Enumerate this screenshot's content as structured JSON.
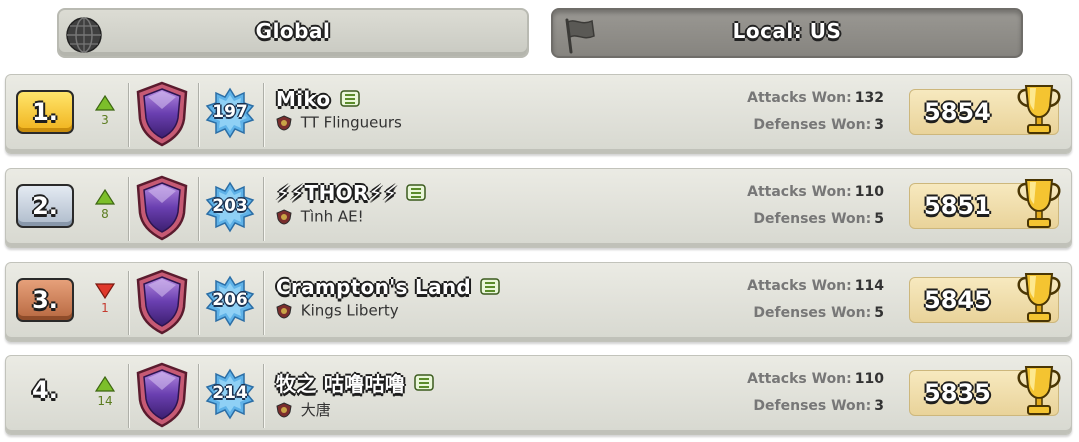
{
  "tabs": {
    "global": {
      "label": "Global",
      "icon": "globe-icon"
    },
    "local": {
      "label": "Local: US",
      "icon": "flag-icon"
    }
  },
  "labels": {
    "attacks_won": "Attacks Won:",
    "defenses_won": "Defenses Won:"
  },
  "players": [
    {
      "rank": "1.",
      "trend": "up",
      "trend_value": "3",
      "level": "197",
      "name": "Miko",
      "clan": "TT Flingueurs",
      "attacks_won": "132",
      "defenses_won": "3",
      "trophies": "5854"
    },
    {
      "rank": "2.",
      "trend": "up",
      "trend_value": "8",
      "level": "203",
      "name": "⚡⚡THOR⚡⚡",
      "clan": "Tình AE!",
      "attacks_won": "110",
      "defenses_won": "5",
      "trophies": "5851"
    },
    {
      "rank": "3.",
      "trend": "down",
      "trend_value": "1",
      "level": "206",
      "name": "Crampton's Land",
      "clan": "Kings Liberty",
      "attacks_won": "114",
      "defenses_won": "5",
      "trophies": "5845"
    },
    {
      "rank": "4.",
      "trend": "up",
      "trend_value": "14",
      "level": "214",
      "name": "牧之 咕噜咕噜",
      "clan": "大唐",
      "attacks_won": "110",
      "defenses_won": "3",
      "trophies": "5835"
    }
  ],
  "colors": {
    "gold": "#f0b21c",
    "silver": "#aebbcb",
    "bronze": "#b76840",
    "trend_up": "#7cbf2a",
    "trend_down": "#e0382b",
    "league": "#6a3fb0"
  }
}
